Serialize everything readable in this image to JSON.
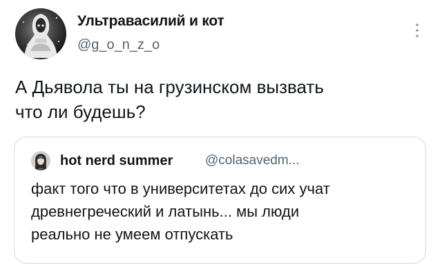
{
  "tweet": {
    "author": {
      "display_name": "Ультравасилий и кот",
      "handle": "@g_o_n_z_o",
      "avatar_icon": "monk-avatar"
    },
    "text": "А Дьявола ты на грузинском вызвать\nчто ли будешь?",
    "more_icon": "more-vertical-icon"
  },
  "quoted_tweet": {
    "author": {
      "display_name": "hot nerd summer",
      "handle": "@colasavedm...",
      "avatar_icon": "girl-avatar"
    },
    "text": "факт того что в университетах до сих учат\nдревнегреческий и латынь... мы люди\nреально не умеем отпускать"
  },
  "colors": {
    "text_primary": "#0f1419",
    "text_secondary": "#536471",
    "border": "#cfd9de",
    "background": "#ffffff"
  }
}
